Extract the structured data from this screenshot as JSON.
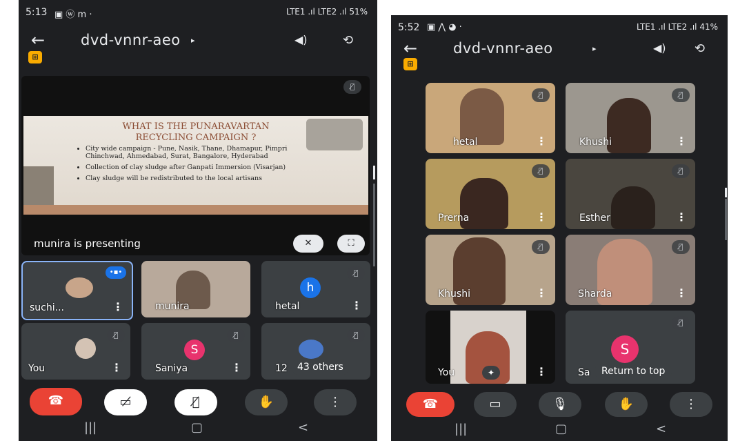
{
  "left": {
    "status": {
      "time": "5:13",
      "time_icons": "▣ ⓦ m ·",
      "right": "LTE1 .ıl LTE2 .ıl 51%"
    },
    "header": {
      "title": "dvd-vnnr-aeo",
      "back_icon": "arrow-left",
      "badge_icon": "meeting-icon"
    },
    "slide": {
      "title_line1": "WHAT IS THE PUNARAVARTAN",
      "title_line2": "RECYCLING CAMPAIGN ?",
      "bullets": [
        "City wide campaign - Pune, Nasik, Thane, Dhamapur, Pimpri Chinchwad, Ahmedabad, Surat, Bangalore, Hyderabad",
        "Collection of clay sludge after Ganpati Immersion (Visarjan)",
        "Clay sludge will be redistributed to the local artisans"
      ]
    },
    "presenting_text": "munira is presenting",
    "tiles": [
      {
        "name": "suchi..."
      },
      {
        "name": "munira"
      },
      {
        "name": "hetal",
        "initial": "h"
      },
      {
        "name": "You"
      },
      {
        "name": "Saniya",
        "initial": "S"
      },
      {
        "name": "12",
        "others": "43 others"
      }
    ],
    "colors": {
      "end_call": "#ea4335",
      "speaking": "#8ab4f8",
      "avatar_blue": "#1a73e8",
      "avatar_pink": "#e8336d"
    }
  },
  "right": {
    "status": {
      "time": "5:52",
      "time_icons": "▣ ⋀ ◕ ·",
      "right": "LTE1 .ıl LTE2 .ıl 41%"
    },
    "header": {
      "title": "dvd-vnnr-aeo"
    },
    "tiles": [
      {
        "name": "hetal"
      },
      {
        "name": "Khushi"
      },
      {
        "name": "Prerna"
      },
      {
        "name": "Esther"
      },
      {
        "name": "Khushi"
      },
      {
        "name": "Sharda"
      },
      {
        "name": "You"
      },
      {
        "name": "Sa",
        "initial": "S",
        "overlay": "Return to top"
      }
    ]
  }
}
